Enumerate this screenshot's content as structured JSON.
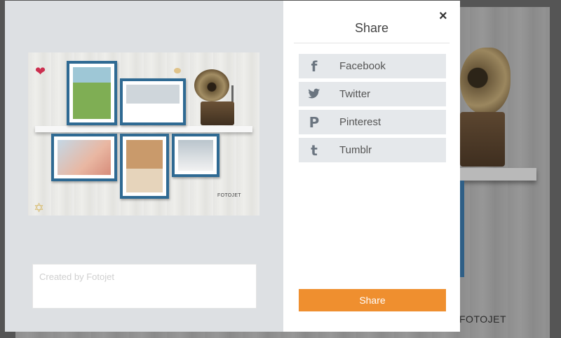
{
  "background": {
    "brand_text": "FOTOJET"
  },
  "preview": {
    "watermark": "FOTOJET",
    "caption_placeholder": "Created by Fotojet"
  },
  "share_panel": {
    "title": "Share",
    "close_glyph": "×",
    "services": [
      {
        "label": "Facebook",
        "icon": "facebook-icon",
        "glyph": "f"
      },
      {
        "label": "Twitter",
        "icon": "twitter-icon",
        "glyph": "🐦"
      },
      {
        "label": "Pinterest",
        "icon": "pinterest-icon",
        "glyph": "P"
      },
      {
        "label": "Tumblr",
        "icon": "tumblr-icon",
        "glyph": "t"
      }
    ],
    "share_button_label": "Share"
  },
  "colors": {
    "share_button": "#ef8f2f",
    "service_row_bg": "#e5e8eb",
    "frame_border": "#2f6a93"
  }
}
